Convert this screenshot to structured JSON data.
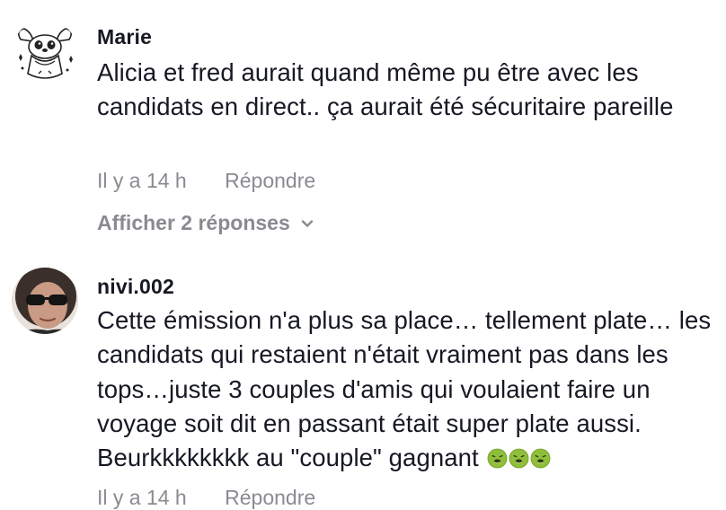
{
  "comments": [
    {
      "username": "Marie",
      "avatar_icon": "stitch-cartoon-avatar",
      "text": "Alicia et fred aurait quand même pu être avec les candidats en direct.. ça aurait été sécuritaire pareille",
      "time": "Il y a 14 h",
      "reply_label": "Répondre",
      "view_replies_label": "Afficher 2 réponses"
    },
    {
      "username": "nivi.002",
      "avatar_icon": "photo-avatar-sunglasses",
      "text": "Cette émission n'a plus sa place… tellement plate… les candidats qui restaient n'était vraiment pas dans les tops…juste 3 couples d'amis qui voulaient faire un voyage soit dit en passant était super plate aussi. Beurkkkkkkkk au \"couple\" gagnant",
      "emoji_name": "nauseated-face-emoji",
      "emoji_count": 3,
      "time": "Il y a 14 h",
      "reply_label": "Répondre"
    }
  ],
  "colors": {
    "text_primary": "#161823",
    "text_secondary": "#8a8b91",
    "emoji_green": "#8fbf3a"
  }
}
